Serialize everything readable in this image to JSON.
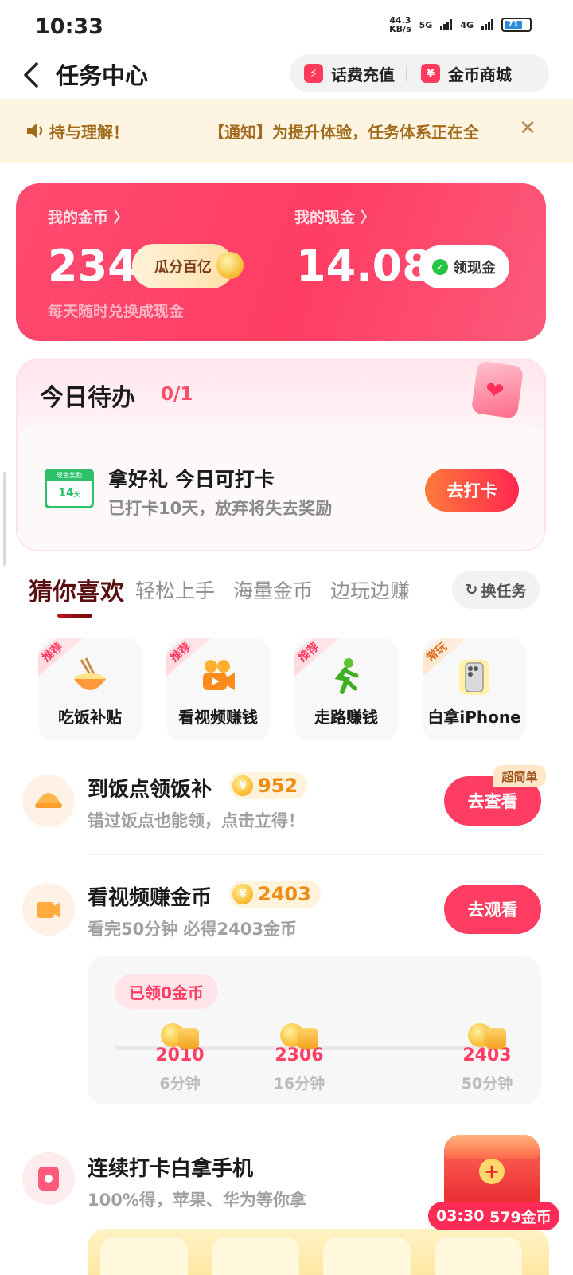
{
  "status_bar": {
    "time": "10:33",
    "net_speed_value": "44.3",
    "net_speed_unit": "KB/s",
    "signal_1": "5G",
    "signal_2": "4G",
    "battery": "71"
  },
  "header": {
    "title": "任务中心",
    "recharge_label": "话费充值",
    "mall_label": "金币商城"
  },
  "notice": {
    "text_left": "持与理解！",
    "text_right": "【通知】为提升体验，任务体系正在全",
    "close": "✕"
  },
  "wallet": {
    "coins_label": "我的金币 〉",
    "coins_value": "234",
    "coins_button": "瓜分百亿",
    "coins_hint": "每天随时兑换成现金",
    "cash_label": "我的现金 〉",
    "cash_value": "14.08",
    "cash_button": "领现金"
  },
  "todo": {
    "title": "今日待办",
    "progress": "0/1",
    "calendar_band": "现金奖励",
    "calendar_num": "14",
    "calendar_unit": "天",
    "task_title": "拿好礼 今日可打卡",
    "task_desc": "已打卡10天，放弃将失去奖励",
    "task_button": "去打卡"
  },
  "tabs": {
    "items": [
      "猜你喜欢",
      "轻松上手",
      "海量金币",
      "边玩边赚"
    ],
    "active_index": 0,
    "swap_label": "换任务"
  },
  "features": [
    {
      "tag": "推荐",
      "label": "吃饭补贴",
      "icon": "noodle-bowl-icon"
    },
    {
      "tag": "推荐",
      "label": "看视频赚钱",
      "icon": "video-camera-icon"
    },
    {
      "tag": "推荐",
      "label": "走路赚钱",
      "icon": "walking-person-icon"
    },
    {
      "tag": "常玩",
      "label": "白拿iPhone",
      "icon": "iphone-icon"
    }
  ],
  "tasks": [
    {
      "name": "到饭点领饭补",
      "coins": "952",
      "desc": "错过饭点也能领，点击立得！",
      "button": "去查看",
      "badge": "超简单",
      "icon": "meal-icon"
    },
    {
      "name": "看视频赚金币",
      "coins": "2403",
      "desc": "看完50分钟 必得2403金币",
      "button": "去观看",
      "icon": "video-icon"
    },
    {
      "name": "连续打卡白拿手机",
      "desc": "100%得，苹果、华为等你拿",
      "icon": "phone-gift-icon"
    }
  ],
  "video_progress": {
    "received": "已领0金币",
    "fill": 0,
    "milestones": [
      {
        "value": "2010",
        "time": "6分钟"
      },
      {
        "value": "2306",
        "time": "16分钟"
      },
      {
        "value": "2403",
        "time": "50分钟"
      }
    ]
  },
  "floating_reward": {
    "countdown": "03:30",
    "coins": "579金币"
  },
  "colors": {
    "accent": "#ff3d63",
    "notice_bg": "#fdf5e2",
    "notice_text": "#a26b1c",
    "coin_orange": "#f08a10"
  }
}
